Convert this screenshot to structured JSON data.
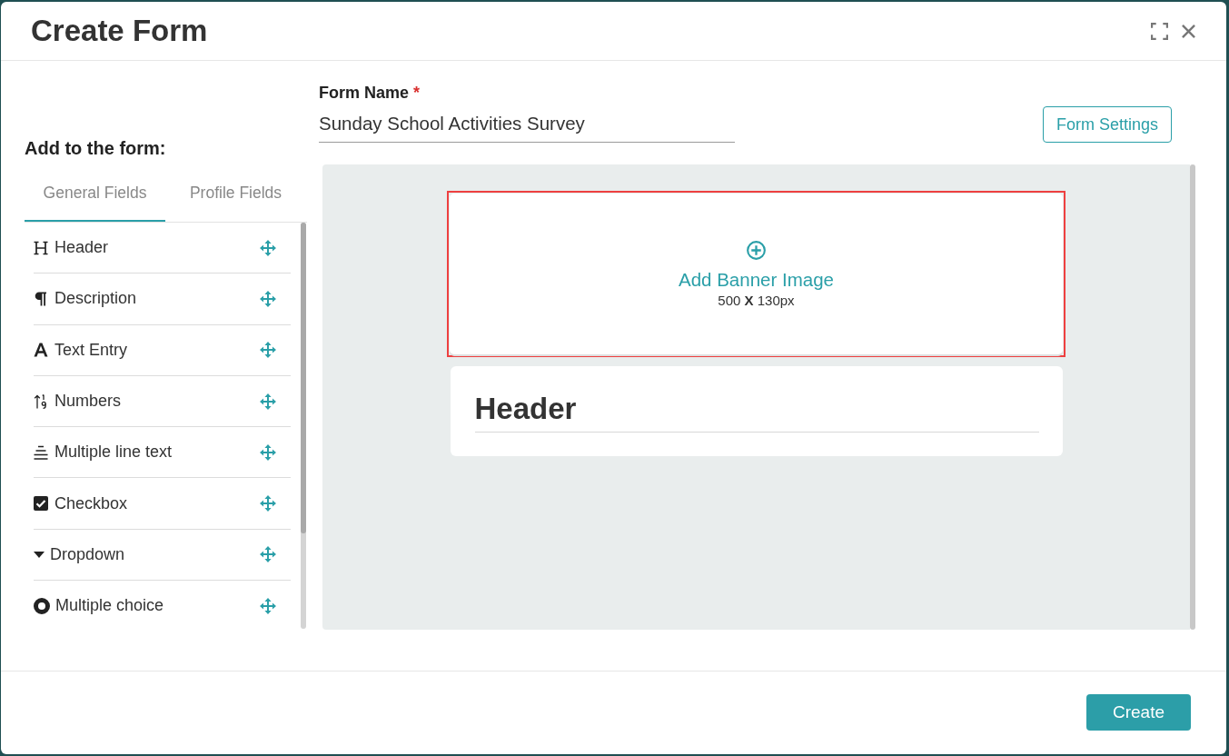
{
  "window": {
    "title": "Create Form"
  },
  "sidebar": {
    "heading": "Add to the form:",
    "tabs": [
      {
        "label": "General Fields",
        "selected": true
      },
      {
        "label": "Profile Fields",
        "selected": false
      }
    ],
    "fields": [
      {
        "label": "Header",
        "kind": "heading"
      },
      {
        "label": "Description",
        "kind": "paragraph"
      },
      {
        "label": "Text Entry",
        "kind": "text"
      },
      {
        "label": "Numbers",
        "kind": "numbers"
      },
      {
        "label": "Multiple line text",
        "kind": "multiline"
      },
      {
        "label": "Checkbox",
        "kind": "checkbox"
      },
      {
        "label": "Dropdown",
        "kind": "dropdown"
      },
      {
        "label": "Multiple choice",
        "kind": "radio"
      }
    ]
  },
  "form": {
    "name_label": "Form Name",
    "required_mark": "*",
    "name_value": "Sunday School Activities Survey",
    "settings_button": "Form Settings"
  },
  "canvas": {
    "banner": {
      "title": "Add Banner Image",
      "size": "500 **X** 130px",
      "selected": true
    },
    "blocks": [
      {
        "kind": "header",
        "text": "Header"
      }
    ]
  },
  "footer": {
    "create_button": "Create"
  }
}
